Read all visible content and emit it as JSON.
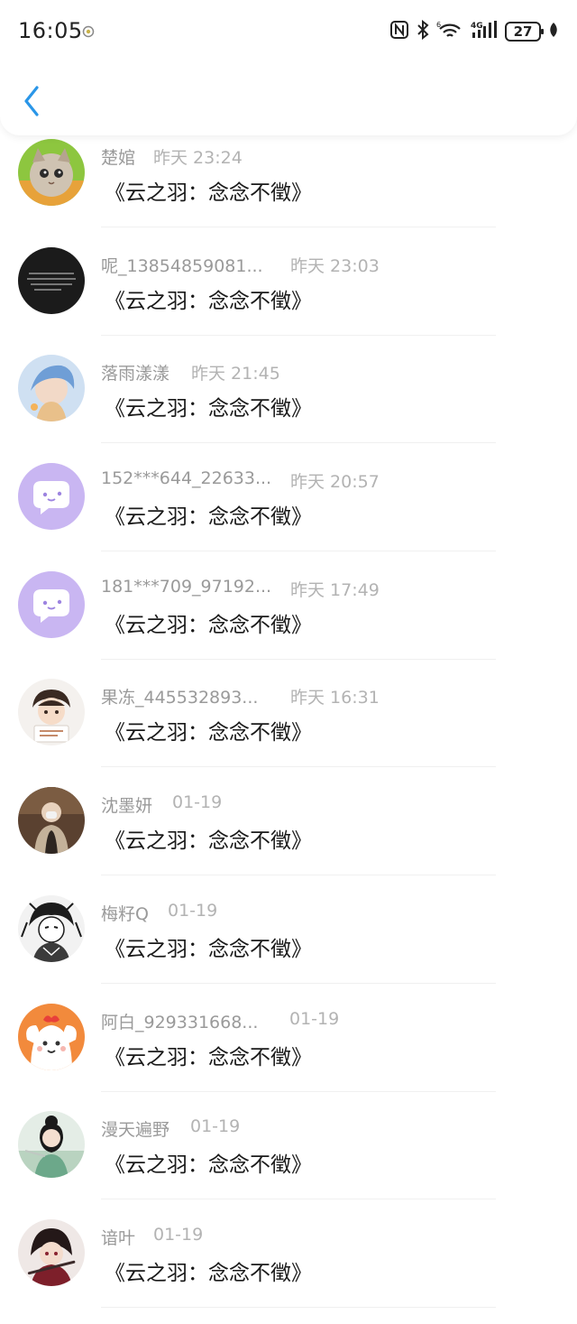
{
  "status_bar": {
    "time": "16:05",
    "battery": "27",
    "icons": [
      "nfc-icon",
      "bluetooth-icon",
      "wifi-icon",
      "signal-4g-icon",
      "battery-icon",
      "leaf-icon"
    ]
  },
  "header": {
    "back_icon": "chevron-left-icon",
    "accent_color": "#2a96e8"
  },
  "rows": [
    {
      "username": "楚婠",
      "time": "昨天 23:24",
      "message": "《云之羽：念念不徵》",
      "avatar": "cat"
    },
    {
      "username": "呢_13854859081...",
      "time": "昨天 23:03",
      "message": "《云之羽：念念不徵》",
      "avatar": "dark-text"
    },
    {
      "username": "落雨漾漾",
      "time": "昨天 21:45",
      "message": "《云之羽：念念不徵》",
      "avatar": "anime-blue"
    },
    {
      "username": "152***644_22633...",
      "time": "昨天 20:57",
      "message": "《云之羽：念念不徵》",
      "avatar": "default-chat"
    },
    {
      "username": "181***709_97192...",
      "time": "昨天 17:49",
      "message": "《云之羽：念念不徵》",
      "avatar": "default-chat"
    },
    {
      "username": "果冻_445532893...",
      "time": "昨天 16:31",
      "message": "《云之羽：念念不徵》",
      "avatar": "cartoon-boy"
    },
    {
      "username": "沈墨妍",
      "time": "01-19",
      "message": "《云之羽：念念不徵》",
      "avatar": "photo"
    },
    {
      "username": "梅籽Q",
      "time": "01-19",
      "message": "《云之羽：念念不徵》",
      "avatar": "manga"
    },
    {
      "username": "阿白_929331668...",
      "time": "01-19",
      "message": "《云之羽：念念不徵》",
      "avatar": "dog-cartoon"
    },
    {
      "username": "漫天遍野",
      "time": "01-19",
      "message": "《云之羽：念念不徵》",
      "avatar": "costume-girl"
    },
    {
      "username": "谙叶",
      "time": "01-19",
      "message": "《云之羽：念念不徵》",
      "avatar": "anime-red"
    }
  ]
}
